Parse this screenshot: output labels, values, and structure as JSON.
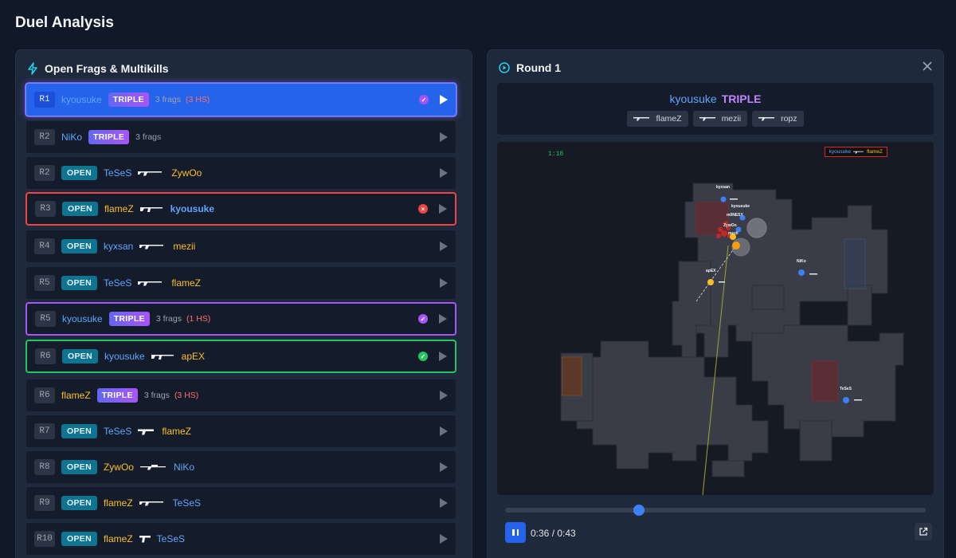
{
  "page": {
    "title": "Duel Analysis"
  },
  "left_panel": {
    "title": "Open Frags & Multikills",
    "rows": [
      {
        "round": "R1",
        "type": "TRIPLE",
        "player": "kyousuke",
        "player_side": "ct",
        "frags": "3 frags",
        "hs": "(3 HS)",
        "state": "selected",
        "status": "purple"
      },
      {
        "round": "R2",
        "type": "TRIPLE",
        "player": "NiKo",
        "player_side": "ct",
        "frags": "3 frags",
        "hs": "",
        "state": "",
        "status": ""
      },
      {
        "round": "R2",
        "type": "OPEN",
        "attacker": "TeSeS",
        "attacker_side": "ct",
        "victim": "ZywOo",
        "victim_side": "t",
        "weapon": "rifle",
        "state": "",
        "status": ""
      },
      {
        "round": "R3",
        "type": "OPEN",
        "attacker": "flameZ",
        "attacker_side": "t",
        "victim": "kyousuke",
        "victim_side": "ct",
        "weapon": "ak",
        "state": "red",
        "status": "red"
      },
      {
        "round": "R4",
        "type": "OPEN",
        "attacker": "kyxsan",
        "attacker_side": "ct",
        "victim": "mezii",
        "victim_side": "t",
        "weapon": "rifle",
        "state": "",
        "status": ""
      },
      {
        "round": "R5",
        "type": "OPEN",
        "attacker": "TeSeS",
        "attacker_side": "ct",
        "victim": "flameZ",
        "victim_side": "t",
        "weapon": "rifle",
        "state": "",
        "status": ""
      },
      {
        "round": "R5",
        "type": "TRIPLE",
        "player": "kyousuke",
        "player_side": "ct",
        "frags": "3 frags",
        "hs": "(1 HS)",
        "state": "purple",
        "status": "purple"
      },
      {
        "round": "R6",
        "type": "OPEN",
        "attacker": "kyousuke",
        "attacker_side": "ct",
        "victim": "apEX",
        "victim_side": "t",
        "weapon": "ak",
        "state": "green",
        "status": "green"
      },
      {
        "round": "R6",
        "type": "TRIPLE",
        "player": "flameZ",
        "player_side": "t",
        "frags": "3 frags",
        "hs": "(3 HS)",
        "state": "",
        "status": ""
      },
      {
        "round": "R7",
        "type": "OPEN",
        "attacker": "TeSeS",
        "attacker_side": "ct",
        "victim": "flameZ",
        "victim_side": "t",
        "weapon": "smg",
        "state": "",
        "status": ""
      },
      {
        "round": "R8",
        "type": "OPEN",
        "attacker": "ZywOo",
        "attacker_side": "t",
        "victim": "NiKo",
        "victim_side": "ct",
        "weapon": "awp",
        "state": "",
        "status": ""
      },
      {
        "round": "R9",
        "type": "OPEN",
        "attacker": "flameZ",
        "attacker_side": "t",
        "victim": "TeSeS",
        "victim_side": "ct",
        "weapon": "rifle",
        "state": "",
        "status": ""
      },
      {
        "round": "R10",
        "type": "OPEN",
        "attacker": "flameZ",
        "attacker_side": "t",
        "victim": "TeSeS",
        "victim_side": "ct",
        "weapon": "pistol",
        "state": "",
        "status": ""
      }
    ]
  },
  "right_panel": {
    "title": "Round 1",
    "summary": {
      "player": "kyousuke",
      "kind": "TRIPLE",
      "victims": [
        "flameZ",
        "mezii",
        "ropz"
      ]
    },
    "map": {
      "timer": "1:18",
      "killfeed": {
        "attacker": "kyousuke",
        "victim": "flameZ"
      },
      "player_labels": [
        "kyxsan",
        "kyousuke",
        "m0NESY",
        "ZywOo",
        "mezii",
        "apEX",
        "NiKo",
        "TeSeS"
      ]
    },
    "playback": {
      "progress": 0.318,
      "time": "0:36 / 0:43"
    }
  },
  "colors": {
    "ct": "#60a5fa",
    "t": "#fbbf24",
    "accent": "#2563eb",
    "triple": "#a855f7"
  }
}
